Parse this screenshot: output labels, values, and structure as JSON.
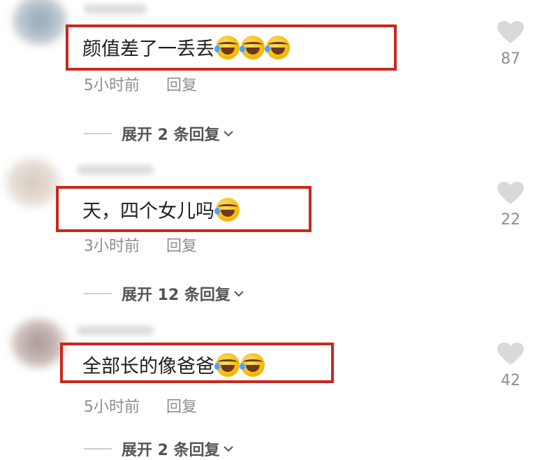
{
  "comments": [
    {
      "text": "颜值差了一丢丢",
      "time": "5小时前",
      "reply": "回复",
      "expand": "展开 2 条回复",
      "likes": "87",
      "emoji_count": 3,
      "avatar_color": "#7f95a8"
    },
    {
      "text": "天，四个女儿吗",
      "time": "3小时前",
      "reply": "回复",
      "expand": "展开 12 条回复",
      "likes": "22",
      "emoji_count": 1,
      "avatar_color": "#c9b8a8"
    },
    {
      "text": "全部长的像爸爸",
      "time": "5小时前",
      "reply": "回复",
      "expand": "展开 2 条回复",
      "likes": "42",
      "emoji_count": 2,
      "avatar_color": "#b9a29a"
    }
  ],
  "colors": {
    "highlight_box": "#c8281e",
    "meta_text": "#8e8e8e",
    "heart": "#d9d9d9"
  },
  "icons": [
    "heart-icon",
    "chevron-down-icon",
    "laughing-crying-emoji"
  ]
}
